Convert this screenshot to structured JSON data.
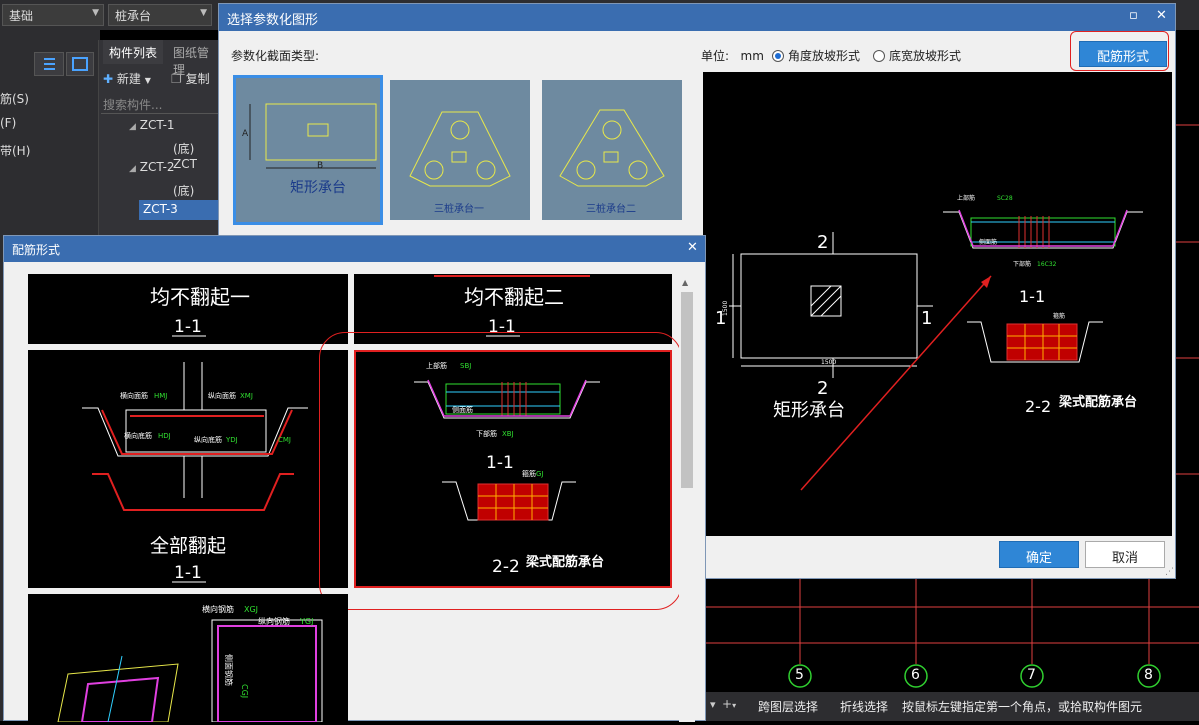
{
  "topbar": {
    "combo1": "基础",
    "combo2": "桩承台"
  },
  "left_menu": [
    "筋(S)",
    "(F)",
    "带(H)"
  ],
  "tree_panel": {
    "tab1": "构件列表",
    "tab2": "图纸管理",
    "new_label": "新建",
    "copy_label": "复制",
    "search_placeholder": "搜索构件...",
    "items": [
      "ZCT-1",
      "(底) ZCT",
      "ZCT-2",
      "(底) ZCT",
      "ZCT-3"
    ]
  },
  "param_dialog": {
    "title": "选择参数化图形",
    "section_label": "参数化截面类型:",
    "unit_label": "单位:",
    "unit_value": "mm",
    "radio1": "角度放坡形式",
    "radio2": "底宽放坡形式",
    "rebar_button": "配筋形式",
    "ok_button": "确定",
    "cancel_button": "取消",
    "thumbs": [
      "矩形承台",
      "三桩承台一",
      "三桩承台二"
    ],
    "preview": {
      "section_marks": [
        "2",
        "2",
        "1",
        "1"
      ],
      "width_dim": "1500",
      "height_dim": "1500",
      "caption": "矩形承台",
      "detail_caption": "梁式配筋承台",
      "label_11": "1-1",
      "label_22": "2-2",
      "top_bar": "上部筋",
      "top_bar_code": "SC28",
      "side_bar": "侧面筋",
      "bottom_bar": "下部筋",
      "bottom_bar_code": "16C32",
      "stirrup": "箍筋"
    }
  },
  "rebar_dialog": {
    "title": "配筋形式",
    "cells": [
      {
        "caption": "均不翻起一",
        "sub": "1-1"
      },
      {
        "caption": "均不翻起二",
        "sub": "1-1"
      },
      {
        "caption": "全部翻起",
        "sub": "1-1"
      },
      {
        "caption": "梁式配筋承台",
        "sub1": "1-1",
        "sub2": "2-2"
      }
    ],
    "labels": {
      "transverse_top": "横向面筋",
      "transverse_top_code": "HMJ",
      "longitudinal_top": "纵向面筋",
      "longitudinal_top_code": "XMJ",
      "transverse_bottom": "横向底筋",
      "transverse_bottom_code": "HDJ",
      "longitudinal_bottom": "纵向底筋",
      "longitudinal_bottom_code": "YDJ",
      "side_code": "CMJ",
      "top_rebar": "上部筋",
      "top_rebar_code": "SBJ",
      "side_rebar": "侧面筋",
      "bottom_rebar": "下部筋",
      "bottom_rebar_code": "XBJ",
      "stirrup": "箍筋",
      "stirrup_code": "GJ",
      "trans_rebar": "横向钢筋",
      "trans_rebar_code": "XGJ",
      "long_rebar": "纵向钢筋",
      "long_rebar_code": "YGJ",
      "side_rebar2": "侧面钢筋",
      "side_rebar2_code": "CGJ"
    }
  },
  "axis_labels": [
    "5",
    "6",
    "7",
    "8"
  ],
  "status_bar": {
    "cross_layer": "跨图层选择",
    "polyline": "折线选择",
    "hint": "按鼠标左键指定第一个角点，或拾取构件图元"
  },
  "colors": {
    "title_blue": "#3a6db0",
    "highlight_red": "#e02020",
    "accent_blue": "#2f86d6"
  }
}
